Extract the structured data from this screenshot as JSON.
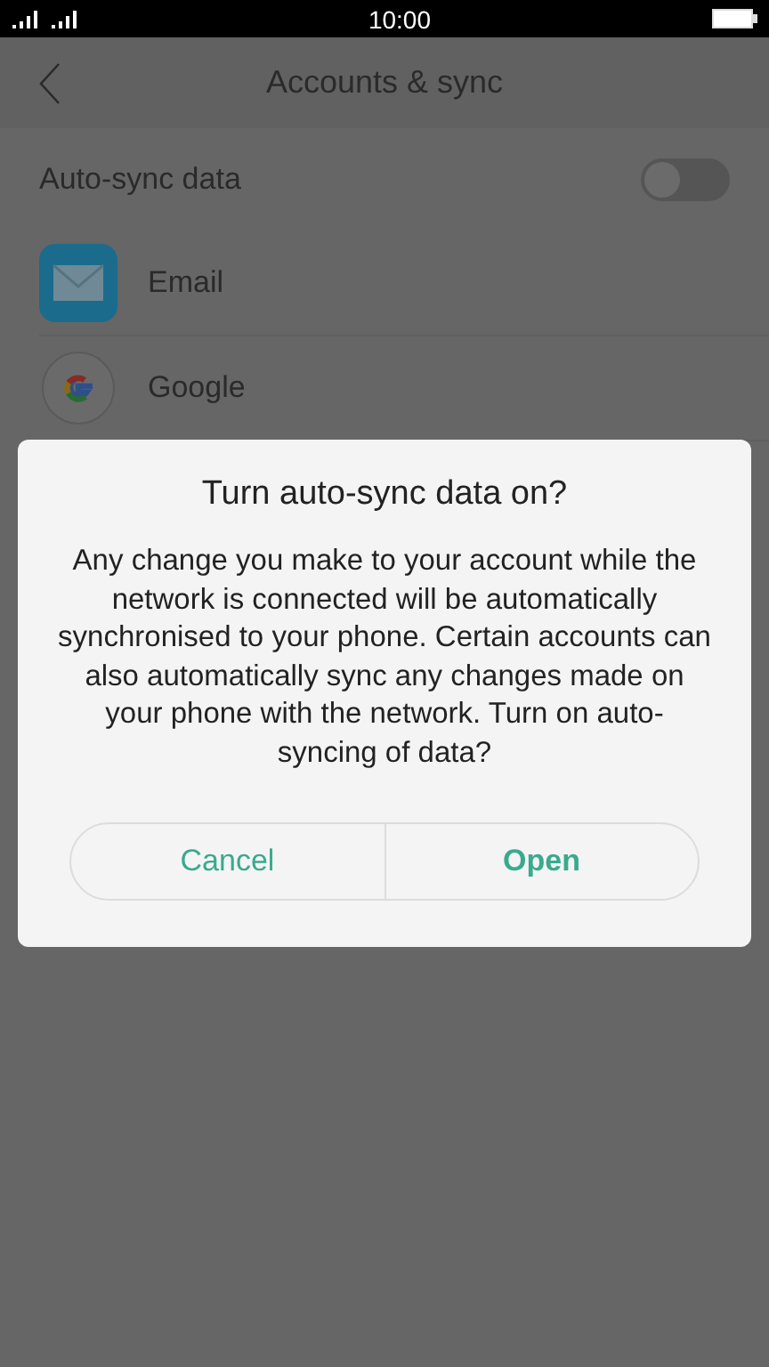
{
  "status_bar": {
    "time": "10:00"
  },
  "header": {
    "title": "Accounts & sync"
  },
  "auto_sync": {
    "label": "Auto-sync data",
    "on": false
  },
  "accounts": [
    {
      "kind": "email",
      "name": "Email"
    },
    {
      "kind": "google",
      "name": "Google"
    }
  ],
  "dialog": {
    "title": "Turn auto-sync data on?",
    "message": "Any change you make to your account while the network is connected will be automatically synchronised to your phone. Certain accounts can also automatically sync any changes made on your phone with the network. Turn on auto-syncing of data?",
    "buttons": [
      {
        "label": "Cancel"
      },
      {
        "label": "Open"
      }
    ]
  }
}
